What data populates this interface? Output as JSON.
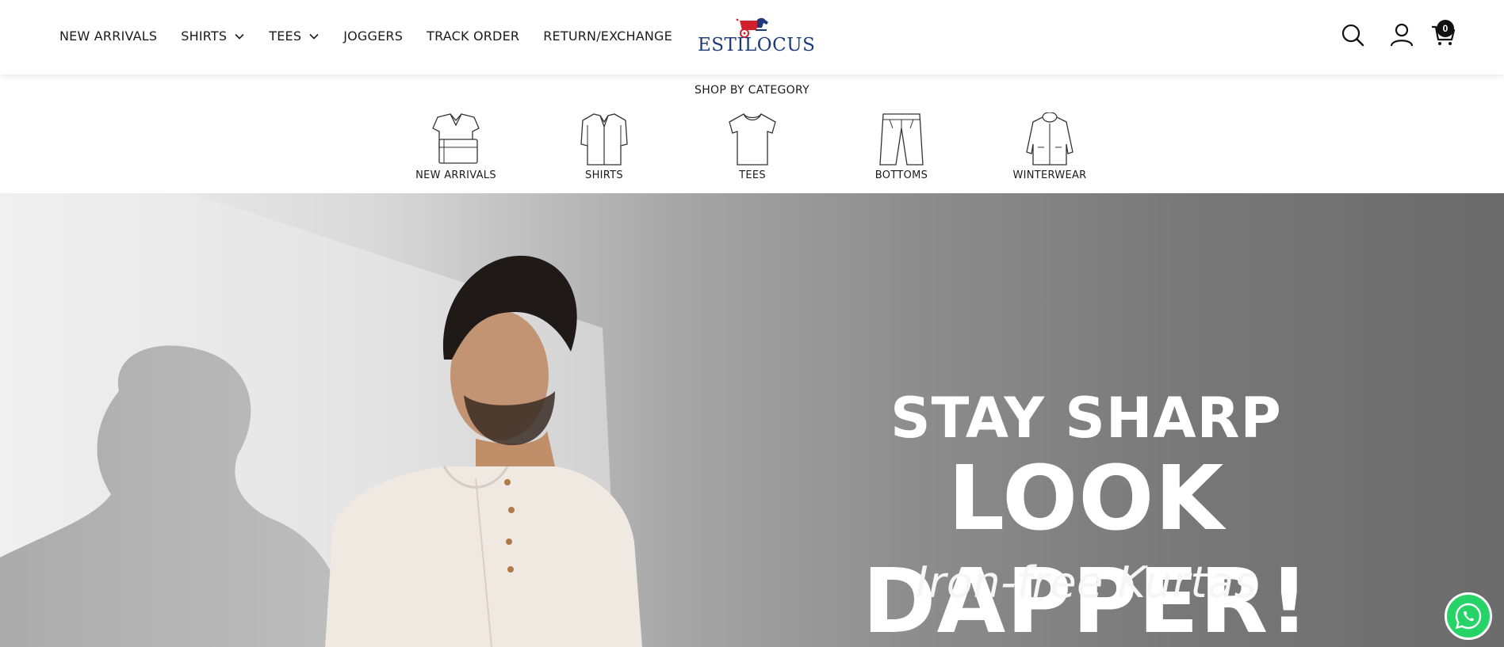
{
  "header": {
    "nav": [
      {
        "label": "NEW ARRIVALS",
        "has_dropdown": false
      },
      {
        "label": "SHIRTS",
        "has_dropdown": true
      },
      {
        "label": "TEES",
        "has_dropdown": true
      },
      {
        "label": "JOGGERS",
        "has_dropdown": false
      },
      {
        "label": "TRACK ORDER",
        "has_dropdown": false
      },
      {
        "label": "RETURN/EXCHANGE",
        "has_dropdown": false
      }
    ],
    "logo_text": "ESTILOCUS",
    "icons": [
      "search-icon",
      "account-icon",
      "cart-icon"
    ],
    "cart_count": "0"
  },
  "categories": {
    "title": "SHOP BY CATEGORY",
    "items": [
      {
        "label": "NEW ARRIVALS",
        "icon": "folded-shirt-icon"
      },
      {
        "label": "SHIRTS",
        "icon": "shirt-icon"
      },
      {
        "label": "TEES",
        "icon": "tshirt-icon"
      },
      {
        "label": "BOTTOMS",
        "icon": "trousers-icon"
      },
      {
        "label": "WINTERWEAR",
        "icon": "jacket-icon"
      }
    ]
  },
  "hero": {
    "line1": "STAY SHARP",
    "line2": "LOOK DAPPER!",
    "line3": "Iron-free Kurtas"
  },
  "colors": {
    "logo_blue": "#1e3a7a",
    "logo_red": "#d0212b",
    "whatsapp_green": "#25d366"
  }
}
